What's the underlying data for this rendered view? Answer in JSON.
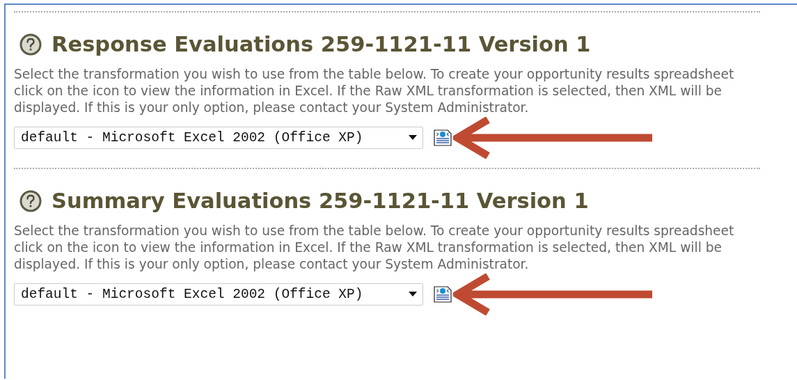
{
  "sections": [
    {
      "title": "Response Evaluations 259-1121-11 Version 1",
      "description": "Select the transformation you wish to use from the table below. To create your opportunity results spreadsheet click on the icon to view the information in Excel. If the Raw XML transformation is selected, then XML will be displayed. If this is your only option, please contact your System Administrator.",
      "transformation": "default - Microsoft Excel 2002 (Office XP)"
    },
    {
      "title": "Summary Evaluations 259-1121-11 Version 1",
      "description": "Select the transformation you wish to use from the table below. To create your opportunity results spreadsheet click on the icon to view the information in Excel. If the Raw XML transformation is selected, then XML will be displayed. If this is your only option, please contact your System Administrator.",
      "transformation": "default - Microsoft Excel 2002 (Office XP)"
    }
  ]
}
